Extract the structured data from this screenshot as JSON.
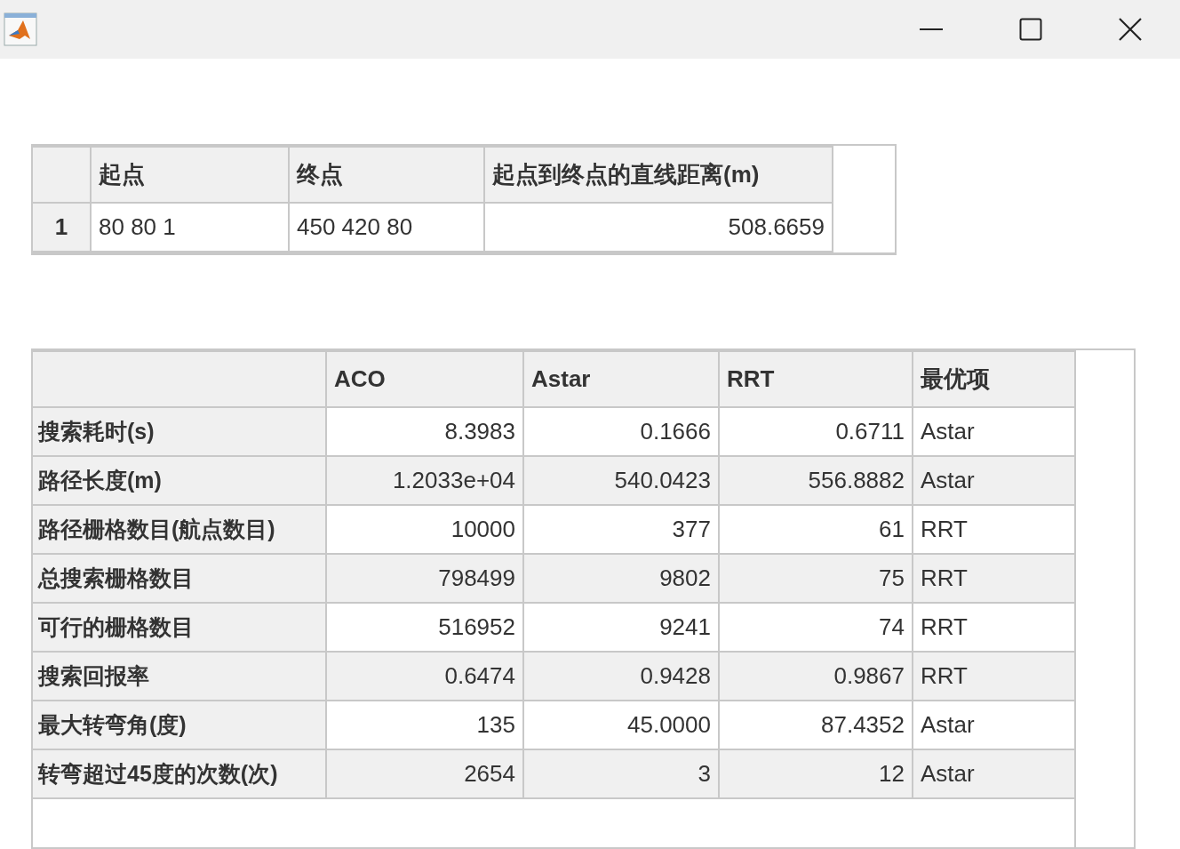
{
  "summary_table": {
    "columns": [
      "起点",
      "终点",
      "起点到终点的直线距离(m)"
    ],
    "rows": [
      {
        "row_number": "1",
        "cells": [
          "80 80 1",
          "450 420 80",
          "508.6659"
        ]
      }
    ]
  },
  "comparison_table": {
    "columns": [
      "ACO",
      "Astar",
      "RRT",
      "最优项"
    ],
    "rows": [
      {
        "label": "搜索耗时(s)",
        "values": [
          "8.3983",
          "0.1666",
          "0.6711"
        ],
        "best": "Astar"
      },
      {
        "label": "路径长度(m)",
        "values": [
          "1.2033e+04",
          "540.0423",
          "556.8882"
        ],
        "best": "Astar"
      },
      {
        "label": "路径栅格数目(航点数目)",
        "values": [
          "10000",
          "377",
          "61"
        ],
        "best": "RRT"
      },
      {
        "label": "总搜索栅格数目",
        "values": [
          "798499",
          "9802",
          "75"
        ],
        "best": "RRT"
      },
      {
        "label": "可行的栅格数目",
        "values": [
          "516952",
          "9241",
          "74"
        ],
        "best": "RRT"
      },
      {
        "label": "搜索回报率",
        "values": [
          "0.6474",
          "0.9428",
          "0.9867"
        ],
        "best": "RRT"
      },
      {
        "label": "最大转弯角(度)",
        "values": [
          "135",
          "45.0000",
          "87.4352"
        ],
        "best": "Astar"
      },
      {
        "label": "转弯超过45度的次数(次)",
        "values": [
          "2654",
          "3",
          "12"
        ],
        "best": "Astar"
      }
    ]
  }
}
